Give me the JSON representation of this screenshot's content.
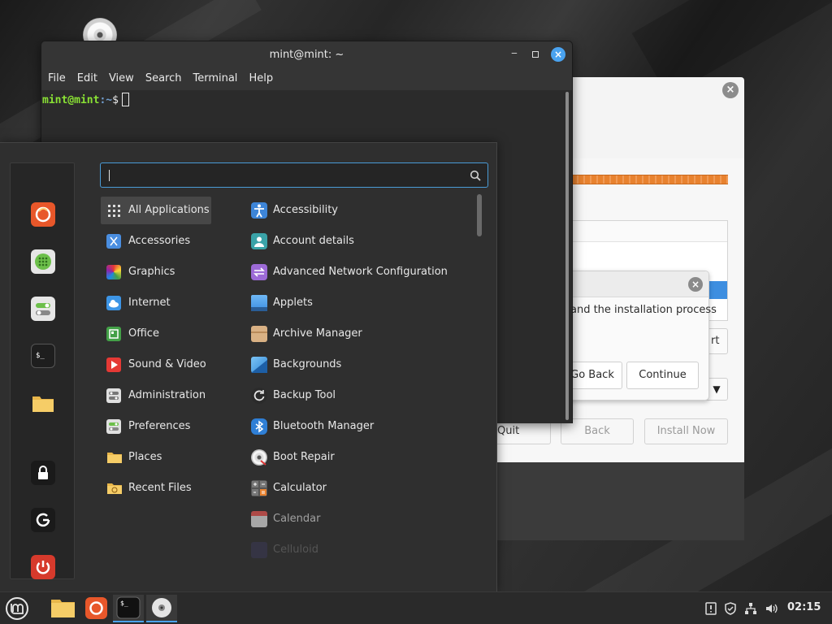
{
  "terminal": {
    "title": "mint@mint: ~",
    "menu": [
      "File",
      "Edit",
      "View",
      "Search",
      "Terminal",
      "Help"
    ],
    "prompt_user": "mint@mint",
    "prompt_path": ":~",
    "prompt_symbol": "$"
  },
  "installer": {
    "restart_fragment": "rt",
    "quit_label": "Quit",
    "back_label": "Back",
    "install_label": "Install Now"
  },
  "dialog": {
    "message": "and the installation process",
    "go_back_label": "Go Back",
    "continue_label": "Continue"
  },
  "menu": {
    "search_placeholder": "",
    "categories": [
      {
        "label": "All Applications",
        "icon": "grid-icon",
        "active": true
      },
      {
        "label": "Accessories",
        "icon": "scissors-icon"
      },
      {
        "label": "Graphics",
        "icon": "graphics-icon"
      },
      {
        "label": "Internet",
        "icon": "cloud-icon"
      },
      {
        "label": "Office",
        "icon": "office-icon"
      },
      {
        "label": "Sound & Video",
        "icon": "play-icon"
      },
      {
        "label": "Administration",
        "icon": "admin-icon"
      },
      {
        "label": "Preferences",
        "icon": "preferences-icon"
      },
      {
        "label": "Places",
        "icon": "folder-icon"
      },
      {
        "label": "Recent Files",
        "icon": "recent-folder-icon"
      }
    ],
    "apps": [
      {
        "label": "Accessibility",
        "icon": "accessibility-icon"
      },
      {
        "label": "Account details",
        "icon": "account-icon"
      },
      {
        "label": "Advanced Network Configuration",
        "icon": "network-config-icon"
      },
      {
        "label": "Applets",
        "icon": "applets-icon"
      },
      {
        "label": "Archive Manager",
        "icon": "archive-icon"
      },
      {
        "label": "Backgrounds",
        "icon": "backgrounds-icon"
      },
      {
        "label": "Backup Tool",
        "icon": "backup-icon"
      },
      {
        "label": "Bluetooth Manager",
        "icon": "bluetooth-icon"
      },
      {
        "label": "Boot Repair",
        "icon": "boot-repair-icon"
      },
      {
        "label": "Calculator",
        "icon": "calculator-icon"
      },
      {
        "label": "Calendar",
        "icon": "calendar-icon"
      },
      {
        "label": "Celluloid",
        "icon": "celluloid-icon"
      }
    ],
    "favorites": [
      "firefox-icon",
      "software-manager-icon",
      "system-settings-icon",
      "terminal-icon",
      "files-icon"
    ],
    "session": [
      "lock-icon",
      "logout-icon",
      "power-icon"
    ]
  },
  "panel": {
    "clock": "02:15",
    "apps": [
      "mint-menu-icon",
      "files-icon",
      "firefox-icon",
      "terminal-icon",
      "disc-icon"
    ],
    "tray": [
      "notification-icon",
      "shield-icon",
      "network-icon",
      "volume-icon"
    ]
  },
  "colors": {
    "accent": "#4aa3f0",
    "progress": "#e8822f",
    "prompt_user": "#8ae234",
    "prompt_path": "#729fcf"
  }
}
